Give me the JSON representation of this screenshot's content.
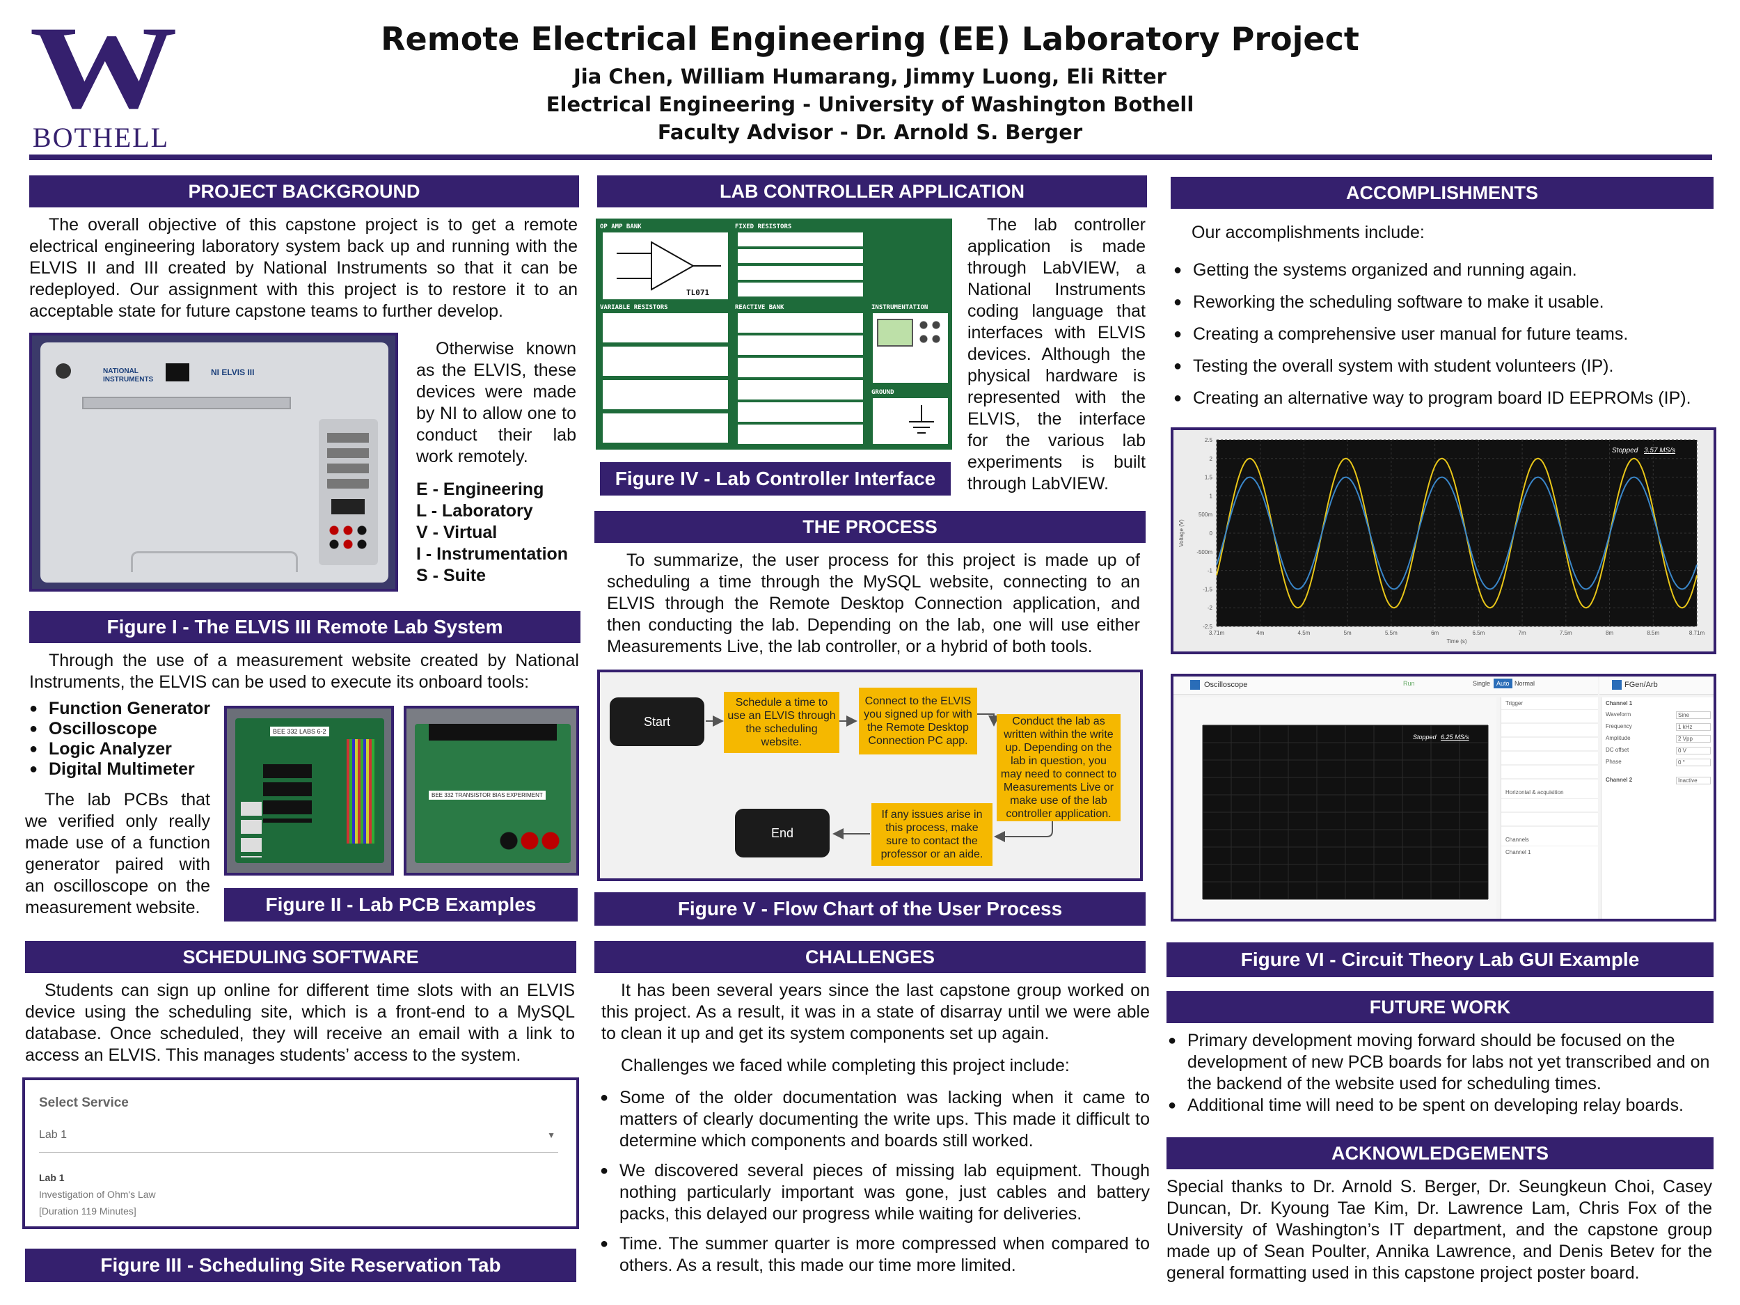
{
  "logo": {
    "letter": "W",
    "sub": "BOTHELL"
  },
  "header": {
    "title": "Remote Electrical Engineering (EE) Laboratory Project",
    "authors": "Jia Chen, William Humarang, Jimmy Luong, Eli Ritter",
    "affiliation": "Electrical Engineering - University of Washington Bothell",
    "advisor": "Faculty Advisor - Dr. Arnold S. Berger"
  },
  "colors": {
    "brand": "#35206e",
    "accent_yellow": "#f5b800",
    "pcb_green": "#1e6b3a"
  },
  "background": {
    "heading": "PROJECT BACKGROUND",
    "para1": "The overall objective of this capstone project is to get a remote electrical engineering laboratory system back up and running with the ELVIS II and III created by National Instruments so that it can be redeployed. Our assignment with this project is to restore it to an acceptable state for future capstone teams to further develop.",
    "para2": "Otherwise known as the ELVIS, these devices were made by NI to allow one to conduct their lab work remotely.",
    "acronym": [
      "E - Engineering",
      "L - Laboratory",
      "V - Virtual",
      "I - Instrumentation",
      "S - Suite"
    ],
    "device_brand": "NATIONAL INSTRUMENTS",
    "device_model": "NI ELVIS III",
    "fig1": "Figure I - The ELVIS III Remote Lab System",
    "para3": "Through the use of a measurement website created by National Instruments, the ELVIS can be used to execute its onboard tools:",
    "tools": [
      "Function Generator",
      "Oscilloscope",
      "Logic Analyzer",
      "Digital Multimeter"
    ],
    "para4": "The lab PCBs that we verified only really made use of a function generator paired with an oscilloscope on the measurement website.",
    "pcb1_label": "BEE 332 LABS 6-2",
    "pcb2_label": "BEE 332 TRANSISTOR BIAS EXPERIMENT",
    "fig2": "Figure II - Lab PCB Examples"
  },
  "scheduling": {
    "heading": "SCHEDULING SOFTWARE",
    "para": "Students can sign up online for different time slots with an ELVIS device using the scheduling site, which is a front-end to a MySQL database. Once scheduled, they will receive an email with a link to access an ELVIS. This manages students’ access to the system.",
    "select_label": "Select Service",
    "select_value": "Lab 1",
    "lab_name": "Lab 1",
    "lab_desc": "Investigation of Ohm's Law",
    "lab_duration": "[Duration 119 Minutes]",
    "fig3": "Figure III - Scheduling Site Reservation Tab"
  },
  "controller": {
    "heading": "LAB CONTROLLER APPLICATION",
    "para": "The lab controller application is made through LabVIEW, a National Instruments coding language that interfaces with ELVIS devices. Although the physical hardware is represented with the ELVIS, the interface for the various lab experiments is built through LabVIEW.",
    "panels": [
      "OP AMP BANK",
      "FIXED RESISTORS",
      "VARIABLE RESISTORS",
      "REACTIVE BANK",
      "INSTRUMENTATION",
      "GROUND"
    ],
    "opamp_label": "TL071",
    "fig4": "Figure IV - Lab Controller Interface"
  },
  "process": {
    "heading": "THE PROCESS",
    "para": "To summarize, the user process for this project is made up of scheduling a time through the MySQL website, connecting to an ELVIS through the Remote Desktop Connection application, and then conducting the lab. Depending on the lab, one will use either Measurements Live, the lab controller, or a hybrid of both tools.",
    "flow": {
      "start": "Start",
      "step1": "Schedule a time to use an ELVIS through the scheduling website.",
      "step2": "Connect to the ELVIS you signed up for with the Remote Desktop Connection PC app.",
      "step3": "Conduct the lab as written within the write up. Depending on the lab in question, you may need to connect to Measurements Live or make use of the lab controller application.",
      "step4": "If any issues arise in this process, make sure to contact the professor or an aide.",
      "end": "End"
    },
    "fig5": "Figure V - Flow Chart of the User Process"
  },
  "challenges": {
    "heading": "CHALLENGES",
    "para1": "It has been several years since the last capstone group worked on this project. As a result, it was in a state of disarray until we were able to clean it up and get its system components set up again.",
    "para2": "Challenges we faced while completing this project include:",
    "items": [
      "Some of the older documentation was lacking when it came to matters of clearly documenting the write ups. This made it difficult to determine which components and boards still worked.",
      "We discovered several pieces of missing lab equipment. Though nothing particularly important was gone, just cables and battery packs, this delayed our progress while waiting for deliveries.",
      "Time. The summer quarter is more compressed when compared to others. As a result, this made our time more limited."
    ]
  },
  "accomplishments": {
    "heading": "ACCOMPLISHMENTS",
    "intro": "Our accomplishments include:",
    "items": [
      "Getting the systems organized and running again.",
      "Reworking the scheduling software to make it usable.",
      "Creating a comprehensive user manual for future teams.",
      "Testing the overall system with student volunteers (IP).",
      "Creating an alternative way to program board ID EEPROMs (IP)."
    ]
  },
  "scope": {
    "status": "Stopped",
    "rate": "3.57 MS/s",
    "yticks": [
      "2.5",
      "2",
      "1.5",
      "1",
      "500m",
      "0",
      "-500m",
      "-1",
      "-1.5",
      "-2",
      "-2.5"
    ],
    "xticks": [
      "3.71m",
      "4m",
      "4.5m",
      "5m",
      "5.5m",
      "6m",
      "6.5m",
      "7m",
      "7.5m",
      "8m",
      "8.5m",
      "8.71m"
    ],
    "ylabel": "Voltage (V)",
    "xlabel": "Time (s)"
  },
  "gui": {
    "tab1": "Oscilloscope",
    "tab2": "FGen/Arb",
    "status": "Stopped",
    "rate": "6.25 MS/s",
    "buttons": [
      "Run",
      "Single",
      "Auto",
      "Normal"
    ],
    "trigger_heading": "Trigger",
    "horizontal_heading": "Horizontal & acquisition",
    "channels_heading": "Channels",
    "ch1": "Channel 1",
    "ch2": "Channel 2",
    "fields": [
      "Waveform",
      "Frequency",
      "Amplitude",
      "DC offset",
      "Phase"
    ],
    "values": [
      "Sine",
      "1 kHz",
      "2 Vpp",
      "0 V",
      "0 °"
    ],
    "ch2_value": "Inactive"
  },
  "fig6": "Figure VI - Circuit Theory Lab GUI Example",
  "future": {
    "heading": "FUTURE WORK",
    "items": [
      "Primary development moving forward should be focused on the development of new PCB boards for labs not yet transcribed and on the backend of the website used for scheduling times.",
      "Additional time will need to be spent on developing relay boards."
    ]
  },
  "acknowledgements": {
    "heading": "ACKNOWLEDGEMENTS",
    "para": "Special thanks to Dr. Arnold S. Berger, Dr. Seungkeun Choi, Casey Duncan, Dr. Kyoung Tae Kim, Dr. Lawrence Lam, Chris Fox of the University of Washington’s IT department, and the capstone group made up of Sean Poulter, Annika Lawrence, and Denis Betev for the general formatting used in this capstone project poster board."
  }
}
